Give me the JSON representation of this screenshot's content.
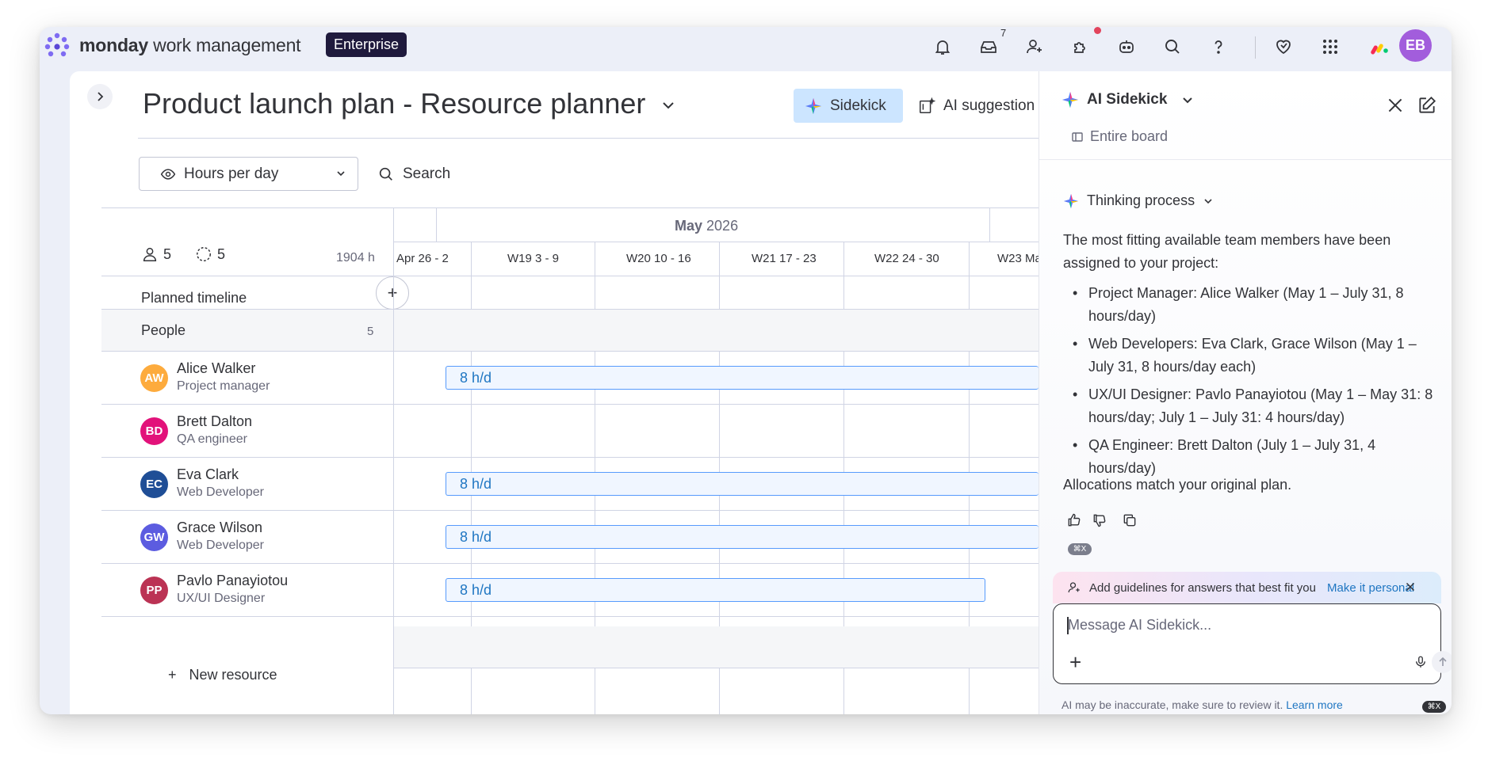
{
  "app": {
    "brand_bold": "monday",
    "brand_rest": " work management",
    "plan_badge": "Enterprise",
    "inbox_count": "7",
    "user_initials": "EB",
    "accent_color": "#0073ea",
    "icons": [
      "notifications-icon",
      "inbox-icon",
      "invite-icon",
      "integrations-icon",
      "ai-bot-icon",
      "search-icon",
      "help-icon",
      "heart-icon",
      "apps-grid-icon",
      "monday-logo-icon"
    ]
  },
  "board": {
    "title": "Product launch plan - Resource planner",
    "sidekick_button": "Sidekick",
    "ai_suggestions_button": "AI suggestion",
    "hours_select": "Hours per day",
    "search_label": "Search"
  },
  "timeline": {
    "month": "May",
    "year": "2026",
    "weeks": [
      "Apr 26 - 2",
      "W19 3 - 9",
      "W20 10 - 16",
      "W21 17 - 23",
      "W22 24 - 30",
      "W23 Ma"
    ],
    "people_count": "5",
    "placeholder_count": "5",
    "total_hours": "1904 h",
    "planned_label": "Planned timeline",
    "plus": "+",
    "group_label": "People",
    "group_count": "5",
    "new_resource": "New resource",
    "new_resource_plus": "+"
  },
  "people": [
    {
      "initials": "AW",
      "name": "Alice Walker",
      "role": "Project manager",
      "color": "#fdab3d",
      "allocation": "8 h/d"
    },
    {
      "initials": "BD",
      "name": "Brett Dalton",
      "role": "QA engineer",
      "color": "#e2127a",
      "allocation": ""
    },
    {
      "initials": "EC",
      "name": "Eva Clark",
      "role": "Web Developer",
      "color": "#1f4e96",
      "allocation": "8 h/d"
    },
    {
      "initials": "GW",
      "name": "Grace Wilson",
      "role": "Web Developer",
      "color": "#5c5ce0",
      "allocation": "8 h/d"
    },
    {
      "initials": "PP",
      "name": "Pavlo Panayiotou",
      "role": "UX/UI Designer",
      "color": "#bb3354",
      "allocation": "8 h/d"
    }
  ],
  "sidekick": {
    "title": "AI Sidekick",
    "scope": "Entire board",
    "thinking": "Thinking process",
    "intro": "The most fitting available team members have been assigned to your project:",
    "items": [
      "Project Manager: Alice Walker (May 1 – July 31, 8 hours/day)",
      "Web Developers: Eva Clark, Grace Wilson (May 1 – July 31, 8 hours/day each)",
      "UX/UI Designer: Pavlo Panayiotou (May 1 – May 31: 8 hours/day; July 1 – July 31: 4 hours/day)",
      "QA Engineer: Brett Dalton (July 1 – July 31, 4 hours/day)"
    ],
    "final": "Allocations match your original plan.",
    "banner_text": "Add guidelines for answers that best fit you",
    "banner_link": "Make it personal",
    "input_placeholder": "Message AI Sidekick...",
    "input_plus": "+",
    "disclaimer": "AI may be inaccurate, make sure to review it.",
    "disclaimer_link": "Learn more",
    "shortcut": "⌘X"
  }
}
